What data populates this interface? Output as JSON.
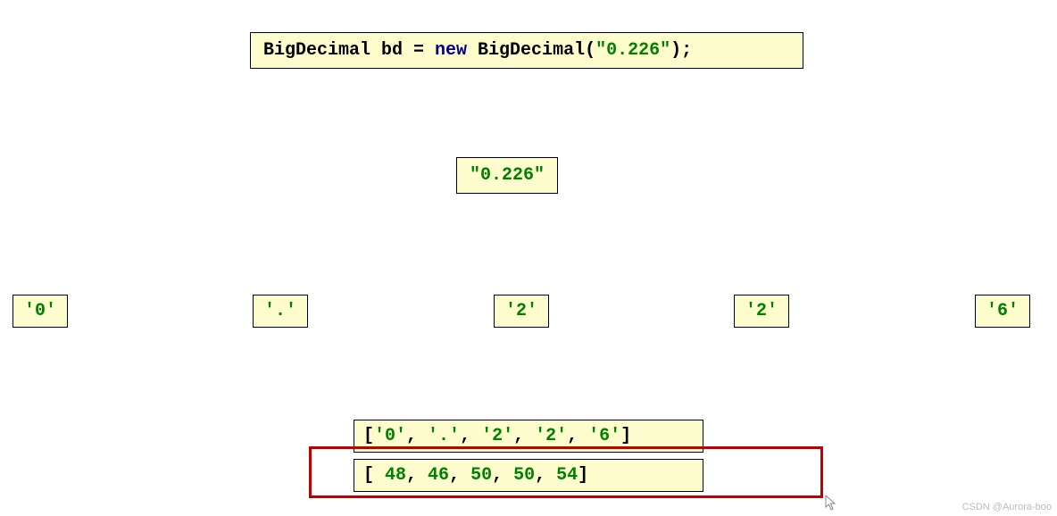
{
  "code": {
    "prefix": "BigDecimal bd = ",
    "keyword": "new",
    "mid": " BigDecimal(",
    "string": "\"0.226\"",
    "suffix": ");"
  },
  "stringValue": "\"0.226\"",
  "chars": {
    "c0": "'0'",
    "c1": "'.'",
    "c2": "'2'",
    "c3": "'2'",
    "c4": "'6'"
  },
  "arrays": {
    "charArray": {
      "open": "[",
      "v0": "'0'",
      "s0": ", ",
      "v1": "'.'",
      "s1": ", ",
      "v2": "'2'",
      "s2": ", ",
      "v3": "'2'",
      "s3": ", ",
      "v4": "'6'",
      "close": "]"
    },
    "intArray": {
      "open": "[ ",
      "v0": "48",
      "s0": ",  ",
      "v1": "46",
      "s1": ",  ",
      "v2": "50",
      "s2": ",  ",
      "v3": "50",
      "s3": ",  ",
      "v4": "54",
      "close": "]"
    }
  },
  "watermark": "CSDN @Aurora-boo"
}
